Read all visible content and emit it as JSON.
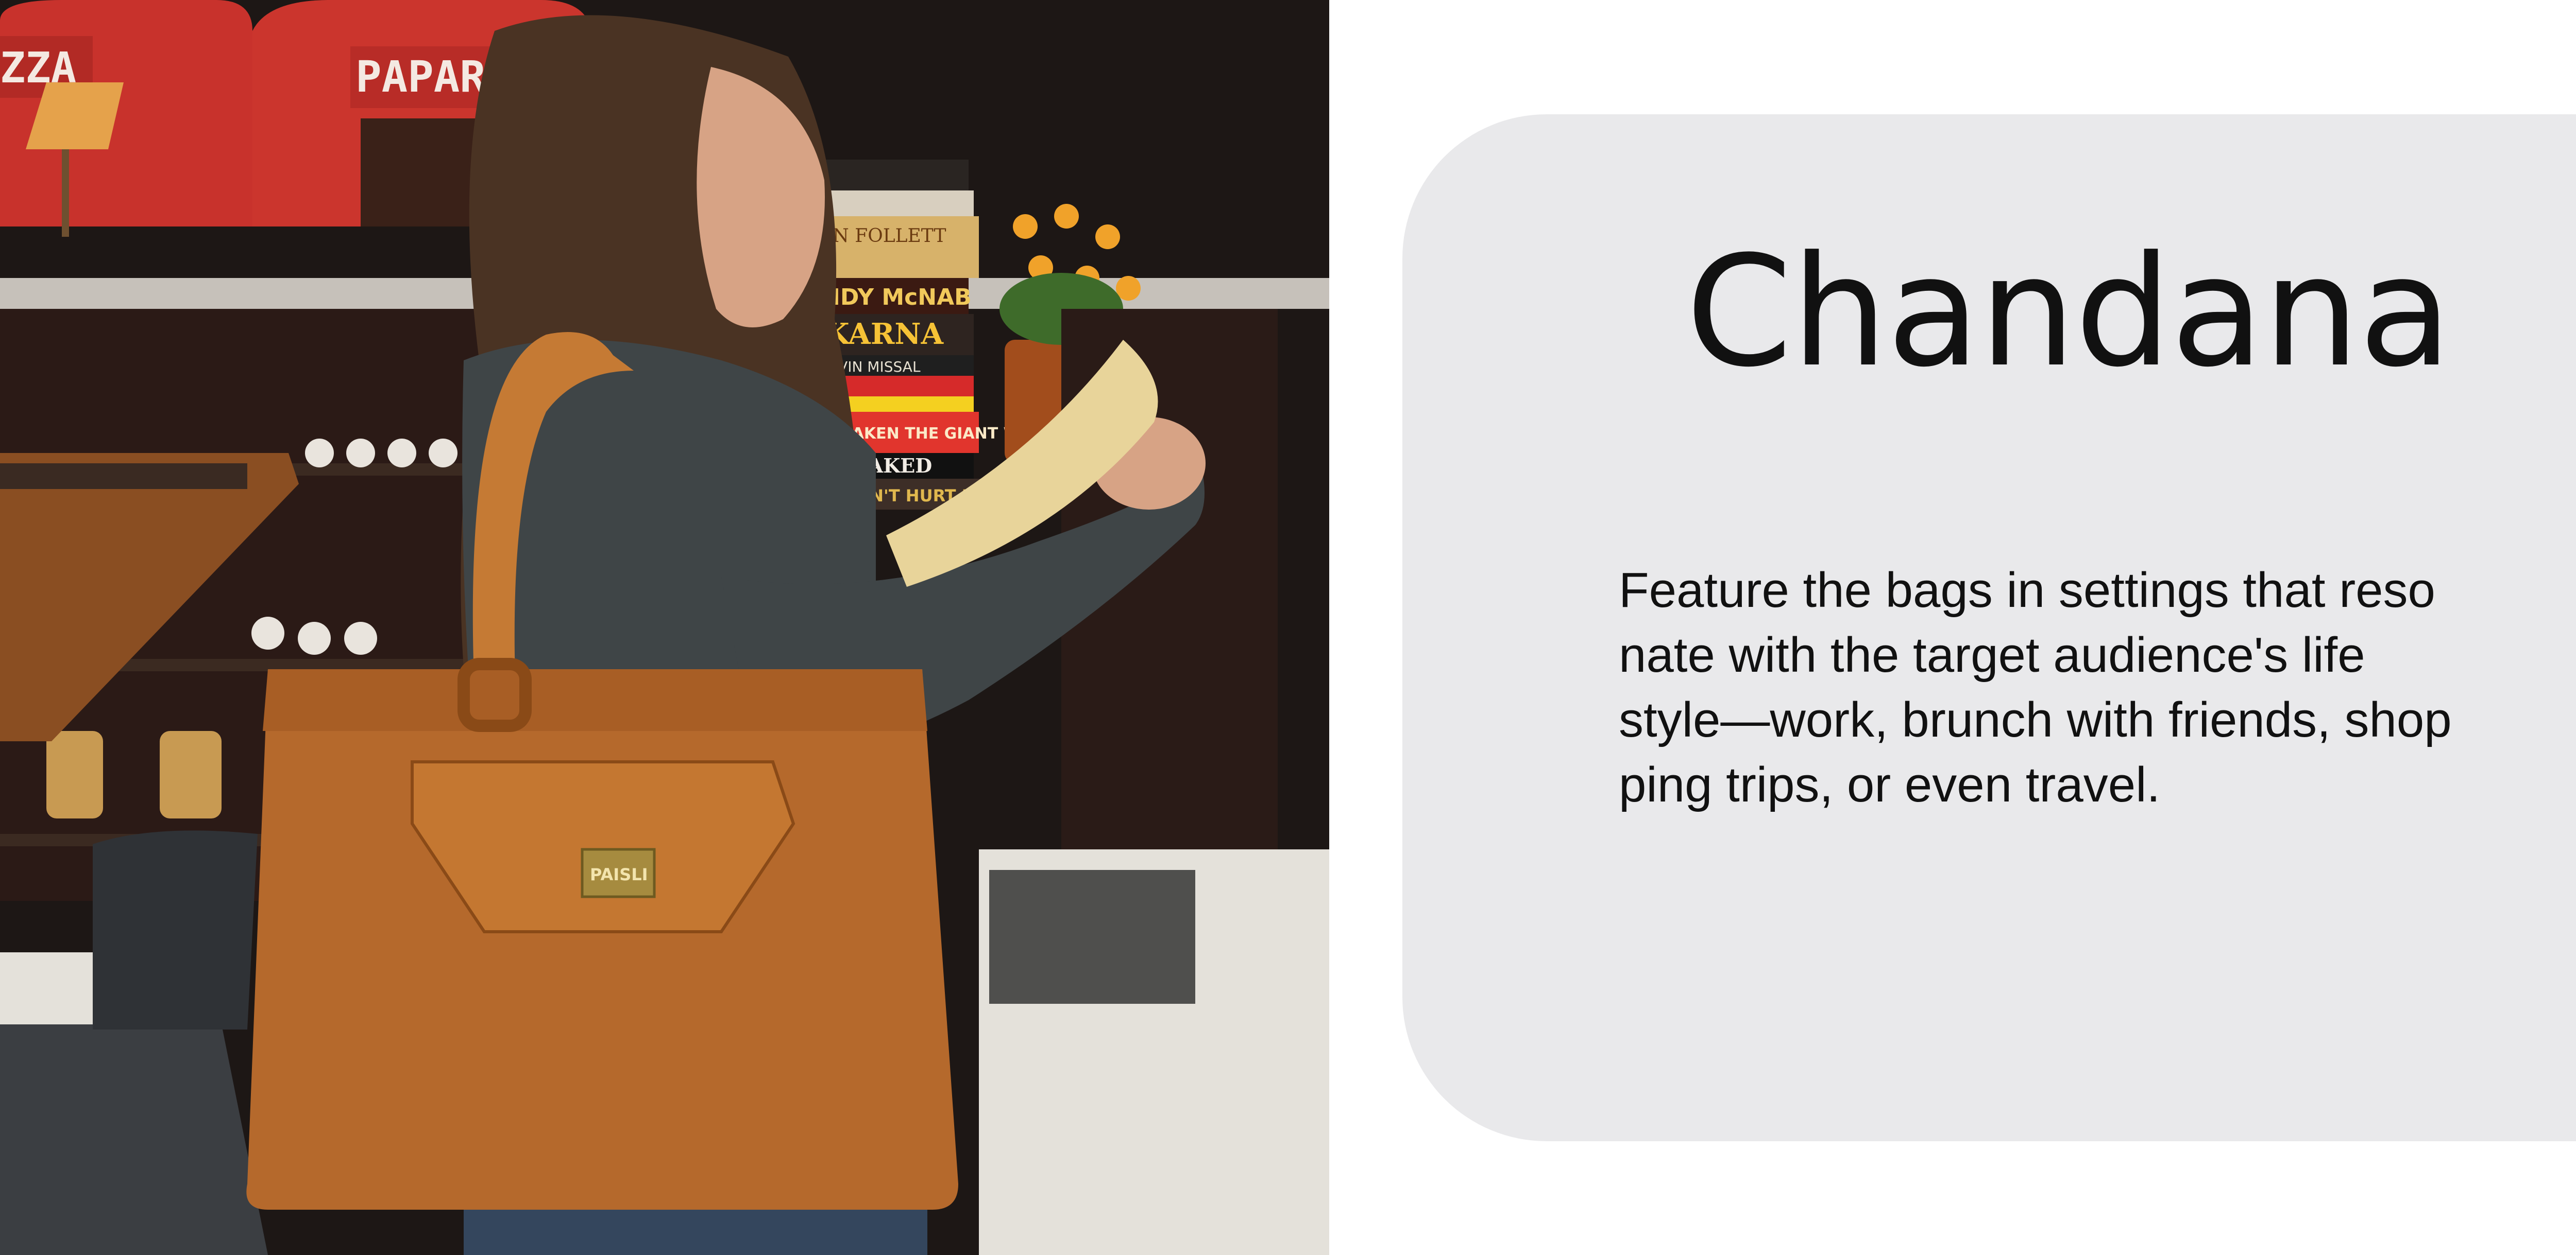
{
  "photo": {
    "signs": [
      "ZZA",
      "PAPARIZZ"
    ],
    "book_spines": [
      "EN FOLLETT",
      "ANDY McNAB",
      "KARNA",
      "KEVIN MISSAL",
      "AWAKEN THE GIANT WITHIN",
      "NAKED",
      "CAN'T HURT ME"
    ],
    "bag_plate": "PAISLI"
  },
  "card": {
    "title": "Chandana",
    "description_lines": [
      "Feature the bags in settings that reso",
      "nate with the target audience's life",
      "style—work, brunch with friends, shop",
      "ping trips, or even travel."
    ]
  },
  "colors": {
    "card_background": "#e9e9eb",
    "title_text": "#111111",
    "bag_tan": "#b5692c",
    "oven_red": "#c8322c"
  }
}
